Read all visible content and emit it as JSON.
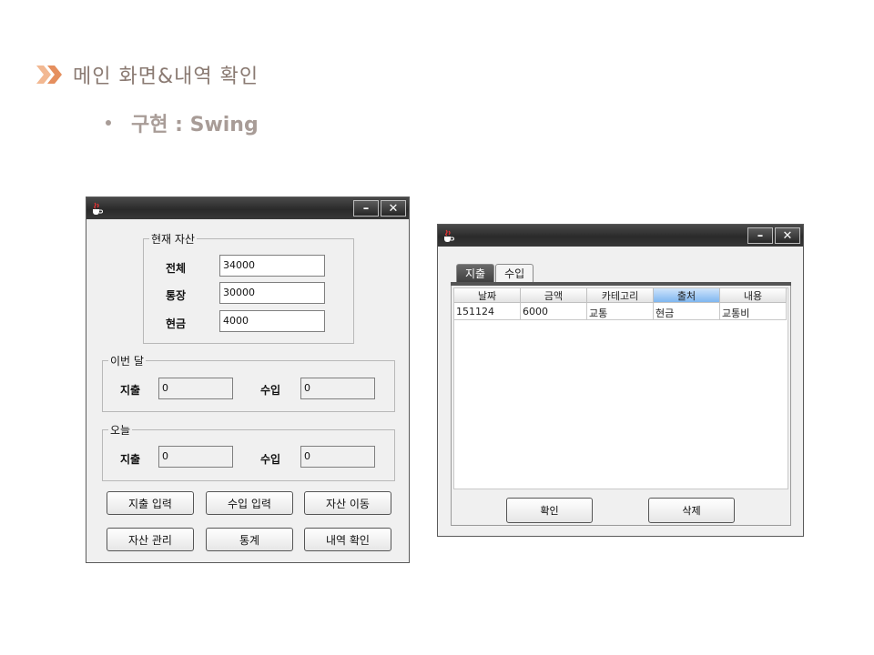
{
  "slide": {
    "title": "메인 화면&내역 확인",
    "bullet": "구현 : Swing",
    "accent_color": "#e8a07a",
    "title_color": "#8a7a72"
  },
  "main_window": {
    "icons": {
      "app": "java-cup-icon",
      "minimize": "minimize-icon",
      "close": "close-icon"
    },
    "current_assets": {
      "legend": "현재 자산",
      "rows": [
        {
          "label": "전체",
          "value": "34000"
        },
        {
          "label": "통장",
          "value": "30000"
        },
        {
          "label": "현금",
          "value": "4000"
        }
      ]
    },
    "this_month": {
      "legend": "이번 달",
      "expense_label": "지출",
      "expense_value": "0",
      "income_label": "수입",
      "income_value": "0"
    },
    "today": {
      "legend": "오늘",
      "expense_label": "지출",
      "expense_value": "0",
      "income_label": "수입",
      "income_value": "0"
    },
    "buttons": [
      "지출 입력",
      "수입 입력",
      "자산 이동",
      "자산 관리",
      "통계",
      "내역 확인"
    ]
  },
  "history_window": {
    "tabs": [
      "지출",
      "수입"
    ],
    "active_tab": "지출",
    "columns": [
      "날짜",
      "금액",
      "카테고리",
      "출처",
      "내용"
    ],
    "selected_column": "출처",
    "rows": [
      [
        "151124",
        "6000",
        "교통",
        "현금",
        "교통비"
      ]
    ],
    "buttons": {
      "confirm": "확인",
      "delete": "삭제"
    }
  }
}
